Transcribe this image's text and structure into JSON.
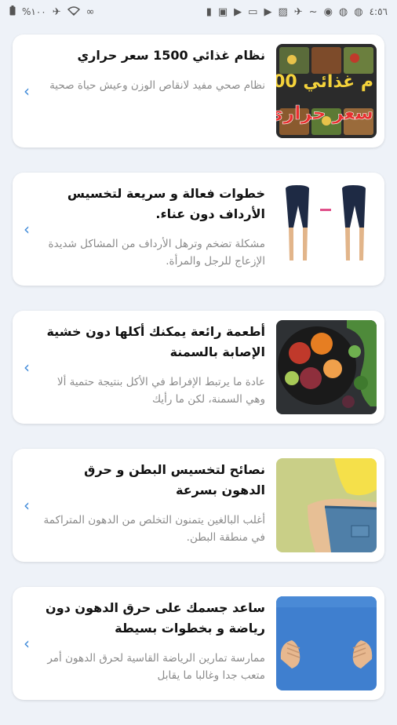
{
  "status_bar": {
    "time": "٤:٥٦",
    "battery": "%١٠٠",
    "left_icons": [
      "battery-icon",
      "airplane-icon",
      "wifi-icon",
      "link-icon"
    ],
    "right_icons": [
      "messenger-icon",
      "messenger-icon",
      "messenger-icon",
      "location-icon",
      "sim-icon",
      "notification-icon",
      "image-icon",
      "youtube-icon",
      "laptop-icon",
      "play-store-icon",
      "screenshot-icon",
      "battery-saver-icon"
    ]
  },
  "articles": [
    {
      "title": "نظام غذائي 1500 سعر حراري",
      "description": "نظام صحي مفيد لانقاص الوزن وعيش حياة صحية",
      "thumb_text_top": "م غذائي 00",
      "thumb_text_bottom": "سعر حراري"
    },
    {
      "title": "خطوات فعالة و سريعة لتخسيس الأرداف دون عناء.",
      "description": "مشكلة تضخم وترهل الأرداف من المشاكل شديدة الإزعاج للرجل والمرأة."
    },
    {
      "title": "أطعمة رائعة يمكنك أكلها دون خشية الإصابة بالسمنة",
      "description": "عادة ما يرتبط الإفراط في الأكل بنتيجة حتمية ألا وهي السمنة، لكن ما رأيك"
    },
    {
      "title": "نصائح لتخسيس البطن و حرق الدهون بسرعة",
      "description": "أغلب البالغين يتمنون التخلص من الدهون المتراكمة في منطقة البطن."
    },
    {
      "title": "ساعد جسمك على حرق الدهون دون رياضة و بخطوات بسيطة",
      "description": "ممارسة تمارين الرياضة القاسية لحرق الدهون أمر متعب جدا وغالبا ما يقابل"
    }
  ],
  "colors": {
    "background": "#eef2f8",
    "card": "#ffffff",
    "chevron": "#3f8ad9",
    "title": "#111111",
    "description": "#8a8a8a"
  }
}
